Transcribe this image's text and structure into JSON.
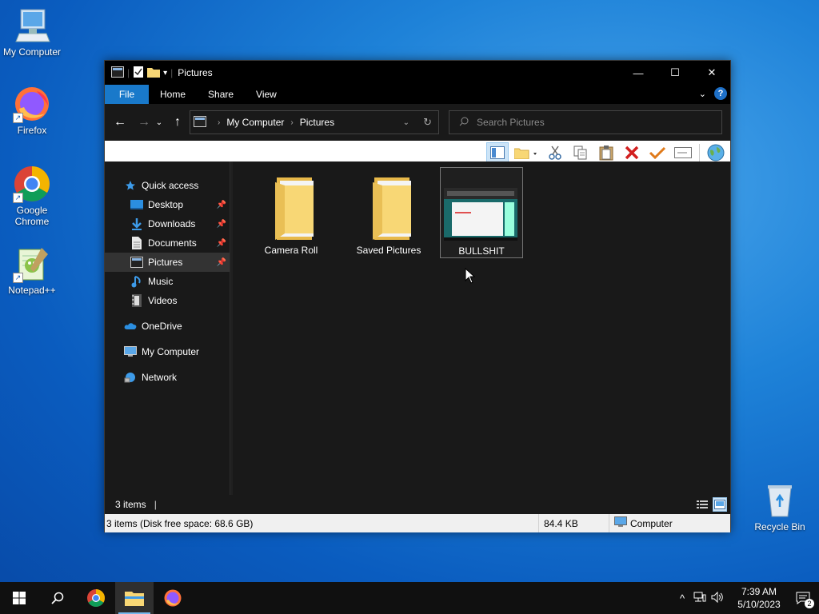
{
  "desktop": {
    "icons": [
      {
        "label": "My Computer",
        "icon": "computer-icon"
      },
      {
        "label": "Firefox",
        "icon": "firefox-icon"
      },
      {
        "label": "Google Chrome",
        "icon": "chrome-icon"
      },
      {
        "label": "Notepad++",
        "icon": "notepadpp-icon"
      },
      {
        "label": "Recycle Bin",
        "icon": "recycle-bin-icon"
      }
    ]
  },
  "window": {
    "title": "Pictures",
    "controls": {
      "minimize": "—",
      "maximize": "☐",
      "close": "✕"
    },
    "ribbon_tabs": [
      "File",
      "Home",
      "Share",
      "View"
    ],
    "help": "?",
    "address": {
      "crumbs": [
        "My Computer",
        "Pictures"
      ]
    },
    "search": {
      "placeholder": "Search Pictures"
    },
    "nav": {
      "quick_access": "Quick access",
      "pinned": [
        "Desktop",
        "Downloads",
        "Documents",
        "Pictures"
      ],
      "unpinned": [
        "Music",
        "Videos"
      ],
      "onedrive": "OneDrive",
      "my_computer": "My Computer",
      "network": "Network",
      "selected": "Pictures"
    },
    "items": [
      {
        "name": "Camera Roll",
        "type": "folder"
      },
      {
        "name": "Saved Pictures",
        "type": "folder"
      },
      {
        "name": "BULLSHIT",
        "type": "image",
        "selected": true
      }
    ],
    "status": {
      "count": "3 items",
      "details": "3 items (Disk free space: 68.6 GB)",
      "size": "84.4 KB",
      "location": "Computer"
    }
  },
  "taskbar": {
    "apps": [
      "start-icon",
      "search-icon",
      "chrome-icon",
      "file-explorer-icon",
      "firefox-icon"
    ],
    "active": "file-explorer-icon",
    "clock": {
      "time": "7:39 AM",
      "date": "5/10/2023"
    },
    "notifications": "2"
  },
  "colors": {
    "accent": "#1979ca",
    "window_bg": "#191919",
    "folder": "#f8d775",
    "selection": "#cce4f7"
  }
}
